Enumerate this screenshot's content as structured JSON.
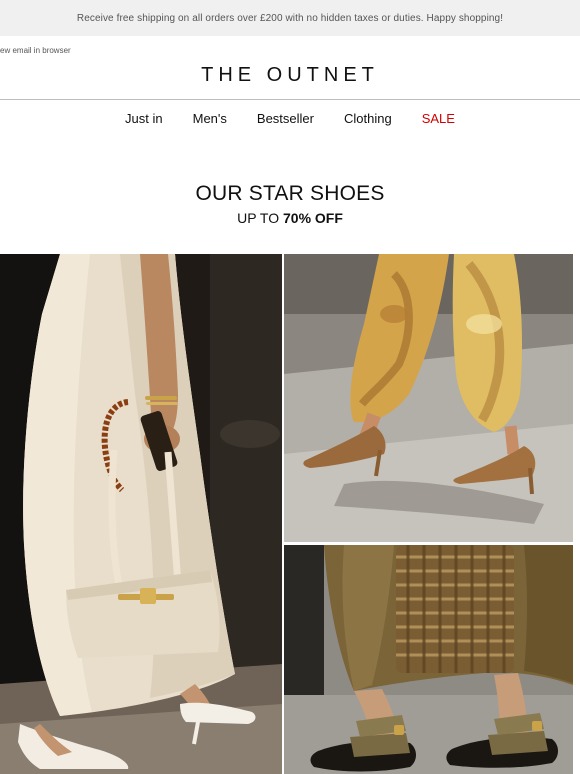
{
  "promo": {
    "text": "Receive free shipping on all orders over £200 with no hidden taxes or duties. Happy shopping!"
  },
  "header": {
    "view_in_browser": "ew email in browser",
    "logo_text": "THE OUTNET"
  },
  "nav": {
    "items": [
      {
        "label": "Just in"
      },
      {
        "label": "Men's"
      },
      {
        "label": "Bestseller"
      },
      {
        "label": "Clothing"
      },
      {
        "label": "SALE"
      }
    ],
    "sale_color": "#d20000"
  },
  "hero": {
    "headline": "OUR STAR SHOES",
    "subhead_prefix": "UP TO ",
    "subhead_emphasis": "70% OFF"
  },
  "images": {
    "left_alt": "Woman in cream dress with cream handbag and slingback heels",
    "top_right_alt": "Woman in printed sheer pants with tan pointed heels",
    "bottom_right_alt": "Person wearing olive strap sandals with woven bag"
  }
}
